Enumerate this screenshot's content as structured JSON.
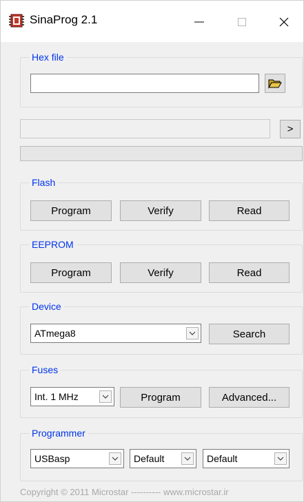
{
  "window": {
    "title": "SinaProg 2.1"
  },
  "hex_file": {
    "legend": "Hex file",
    "path_value": ""
  },
  "command": {
    "value": "",
    "send_label": ">"
  },
  "progress": {
    "fraction": 0
  },
  "flash": {
    "legend": "Flash",
    "program_label": "Program",
    "verify_label": "Verify",
    "read_label": "Read"
  },
  "eeprom": {
    "legend": "EEPROM",
    "program_label": "Program",
    "verify_label": "Verify",
    "read_label": "Read"
  },
  "device": {
    "legend": "Device",
    "selected": "ATmega8",
    "search_label": "Search"
  },
  "fuses": {
    "legend": "Fuses",
    "selected": "Int. 1 MHz",
    "program_label": "Program",
    "advanced_label": "Advanced..."
  },
  "programmer": {
    "legend": "Programmer",
    "programmer_selected": "USBasp",
    "port_selected": "Default",
    "speed_selected": "Default"
  },
  "footer": {
    "text": "Copyright © 2011 Microstar ---------- www.microstar.ir"
  },
  "colors": {
    "legend": "#0033ee",
    "window_bg": "#f0f0f0",
    "button_bg": "#e1e1e1",
    "folder_icon": "#e8c547"
  },
  "icons": {
    "app": "chip-icon",
    "browse": "folder-open-icon"
  }
}
